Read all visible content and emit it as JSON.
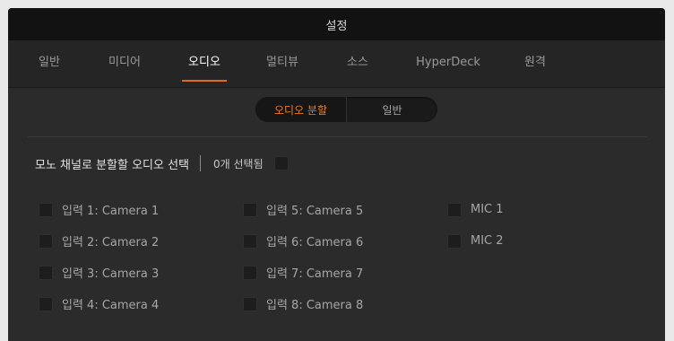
{
  "window": {
    "title": "설정"
  },
  "tabs": [
    {
      "label": "일반",
      "active": false
    },
    {
      "label": "미디어",
      "active": false
    },
    {
      "label": "오디오",
      "active": true
    },
    {
      "label": "멀티뷰",
      "active": false
    },
    {
      "label": "소스",
      "active": false
    },
    {
      "label": "HyperDeck",
      "active": false
    },
    {
      "label": "원격",
      "active": false
    }
  ],
  "segmented": {
    "options": [
      {
        "label": "오디오 분할",
        "active": true
      },
      {
        "label": "일반",
        "active": false
      }
    ]
  },
  "mono": {
    "label": "모노 채널로 분할할 오디오 선택",
    "selected_count": "0개 선택됨",
    "select_all_checked": false
  },
  "inputs": {
    "column1": [
      {
        "label": "입력 1: Camera 1",
        "checked": false
      },
      {
        "label": "입력 2: Camera 2",
        "checked": false
      },
      {
        "label": "입력 3: Camera 3",
        "checked": false
      },
      {
        "label": "입력 4: Camera 4",
        "checked": false
      }
    ],
    "column2": [
      {
        "label": "입력 5: Camera 5",
        "checked": false
      },
      {
        "label": "입력 6: Camera 6",
        "checked": false
      },
      {
        "label": "입력 7: Camera 7",
        "checked": false
      },
      {
        "label": "입력 8: Camera 8",
        "checked": false
      }
    ],
    "column3": [
      {
        "label": "MIC 1",
        "checked": false
      },
      {
        "label": "MIC 2",
        "checked": false
      }
    ]
  },
  "colors": {
    "accent": "#e26a1d",
    "active_segment_text": "#f07c27",
    "panel_bg": "#2b2b2b",
    "titlebar_bg": "#121212"
  }
}
